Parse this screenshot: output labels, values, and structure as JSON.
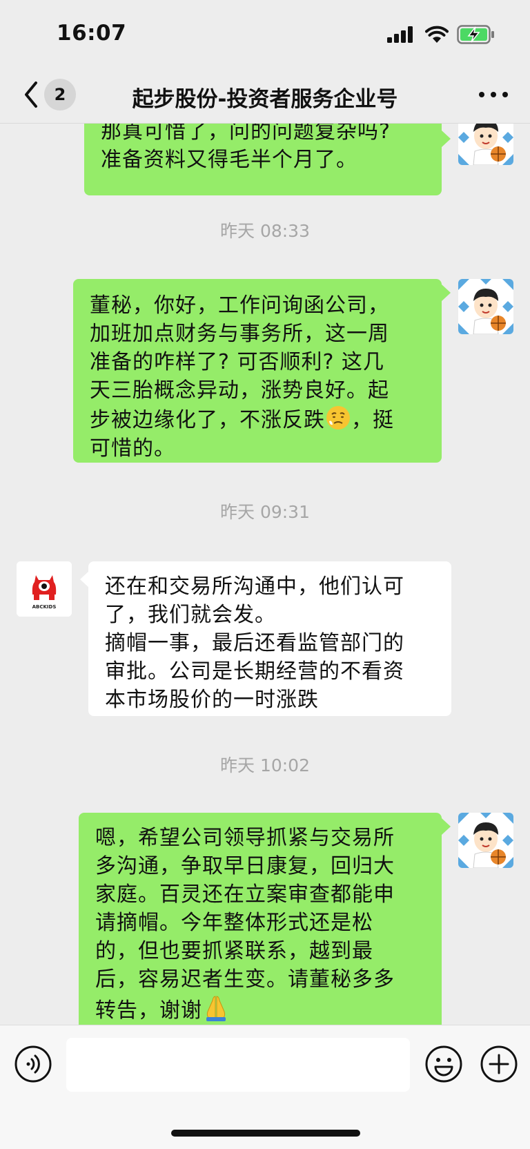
{
  "status_bar": {
    "time": "16:07"
  },
  "nav": {
    "unread_count": "2",
    "title": "起步股份-投资者服务企业号"
  },
  "company_avatar": {
    "label": "ABCKIDS"
  },
  "messages": [
    {
      "type": "sent",
      "lines": [
        "那真可惜了，问的问题复杂吗?",
        "准备资料又得毛半个月了。"
      ]
    },
    {
      "type": "timestamp",
      "text": "昨天 08:33"
    },
    {
      "type": "sent",
      "lines": [
        "董秘，你好，工作问询函公司，",
        "加班加点财务与事务所，这一周",
        "准备的咋样了? 可否顺利? 这几",
        "天三胎概念异动，涨势良好。起",
        "步被边缘化了，不涨反跌",
        "，挺",
        "可惜的。"
      ]
    },
    {
      "type": "timestamp",
      "text": "昨天 09:31"
    },
    {
      "type": "received",
      "lines": [
        "还在和交易所沟通中，他们认可",
        "了，我们就会发。",
        "摘帽一事，最后还看监管部门的",
        "审批。公司是长期经营的不看资",
        "本市场股价的一时涨跌"
      ]
    },
    {
      "type": "timestamp",
      "text": "昨天 10:02"
    },
    {
      "type": "sent",
      "lines": [
        "嗯，希望公司领导抓紧与交易所",
        "多沟通，争取早日康复，回归大",
        "家庭。百灵还在立案审查都能申",
        "请摘帽。今年整体形式还是松",
        "的，但也要抓紧联系，越到最",
        "后，容易迟者生变。请董秘多多",
        "转告，谢谢"
      ]
    }
  ],
  "colors": {
    "sent_bubble": "#95ec69",
    "received_bubble": "#ffffff",
    "background": "#ededed",
    "battery_green": "#4cd964"
  }
}
